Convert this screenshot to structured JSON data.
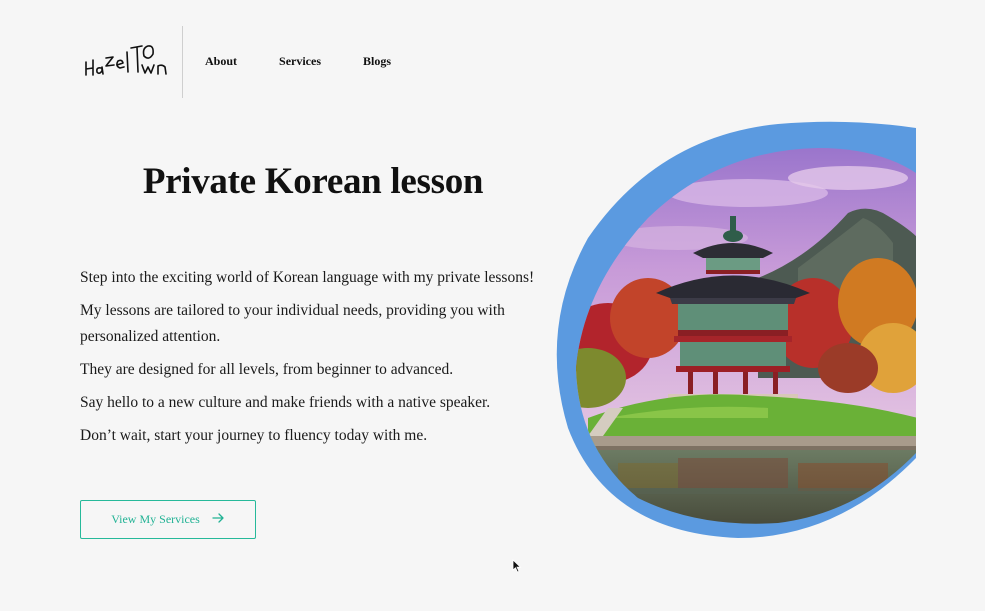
{
  "header": {
    "logo_text": "HazelTown",
    "nav": [
      {
        "label": "About"
      },
      {
        "label": "Services"
      },
      {
        "label": "Blogs"
      }
    ]
  },
  "hero": {
    "title": "Private Korean lesson",
    "paragraphs": [
      "Step into the exciting world of Korean language with my private lessons!",
      "My lessons are tailored to your individual needs, providing you with personalized attention.",
      "They are designed for all levels, from beginner to advanced.",
      "Say hello to a new culture and make friends with a native speaker.",
      "Don’t wait, start your journey to fluency today with me."
    ],
    "cta_label": "View My Services",
    "cta_icon": "arrow-right-icon"
  },
  "colors": {
    "background": "#f6f6f6",
    "accent": "#26b99a",
    "blob": "#5b9ae0"
  }
}
